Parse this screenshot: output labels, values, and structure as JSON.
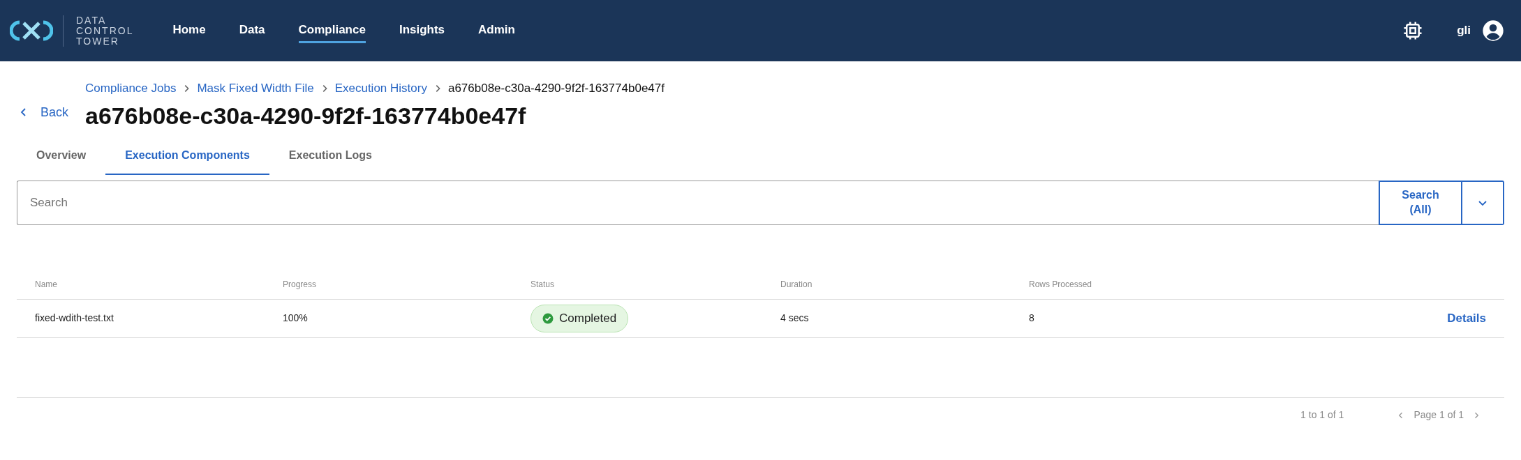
{
  "brand": {
    "lines": [
      "DATA",
      "CONTROL",
      "TOWER"
    ]
  },
  "nav": [
    {
      "label": "Home",
      "selected": false
    },
    {
      "label": "Data",
      "selected": false
    },
    {
      "label": "Compliance",
      "selected": true
    },
    {
      "label": "Insights",
      "selected": false
    },
    {
      "label": "Admin",
      "selected": false
    }
  ],
  "user": {
    "name": "gli"
  },
  "back": "Back",
  "breadcrumbs": [
    {
      "label": "Compliance Jobs",
      "kind": "link"
    },
    {
      "label": "Mask Fixed Width File",
      "kind": "link"
    },
    {
      "label": "Execution History",
      "kind": "link"
    },
    {
      "label": "a676b08e-c30a-4290-9f2f-163774b0e47f",
      "kind": "current"
    }
  ],
  "title": "a676b08e-c30a-4290-9f2f-163774b0e47f",
  "tabs": [
    {
      "label": "Overview",
      "selected": false
    },
    {
      "label": "Execution Components",
      "selected": true
    },
    {
      "label": "Execution Logs",
      "selected": false
    }
  ],
  "search": {
    "placeholder": "Search",
    "button": "Search (All)"
  },
  "table": {
    "columns": [
      "Name",
      "Progress",
      "Status",
      "Duration",
      "Rows Processed"
    ],
    "rows": [
      {
        "name": "fixed-wdith-test.txt",
        "progress": "100%",
        "status": "Completed",
        "duration": "4 secs",
        "rows_processed": "8",
        "action": "Details"
      }
    ]
  },
  "footer": {
    "range": "1 to 1 of 1",
    "page": "Page 1 of 1"
  }
}
